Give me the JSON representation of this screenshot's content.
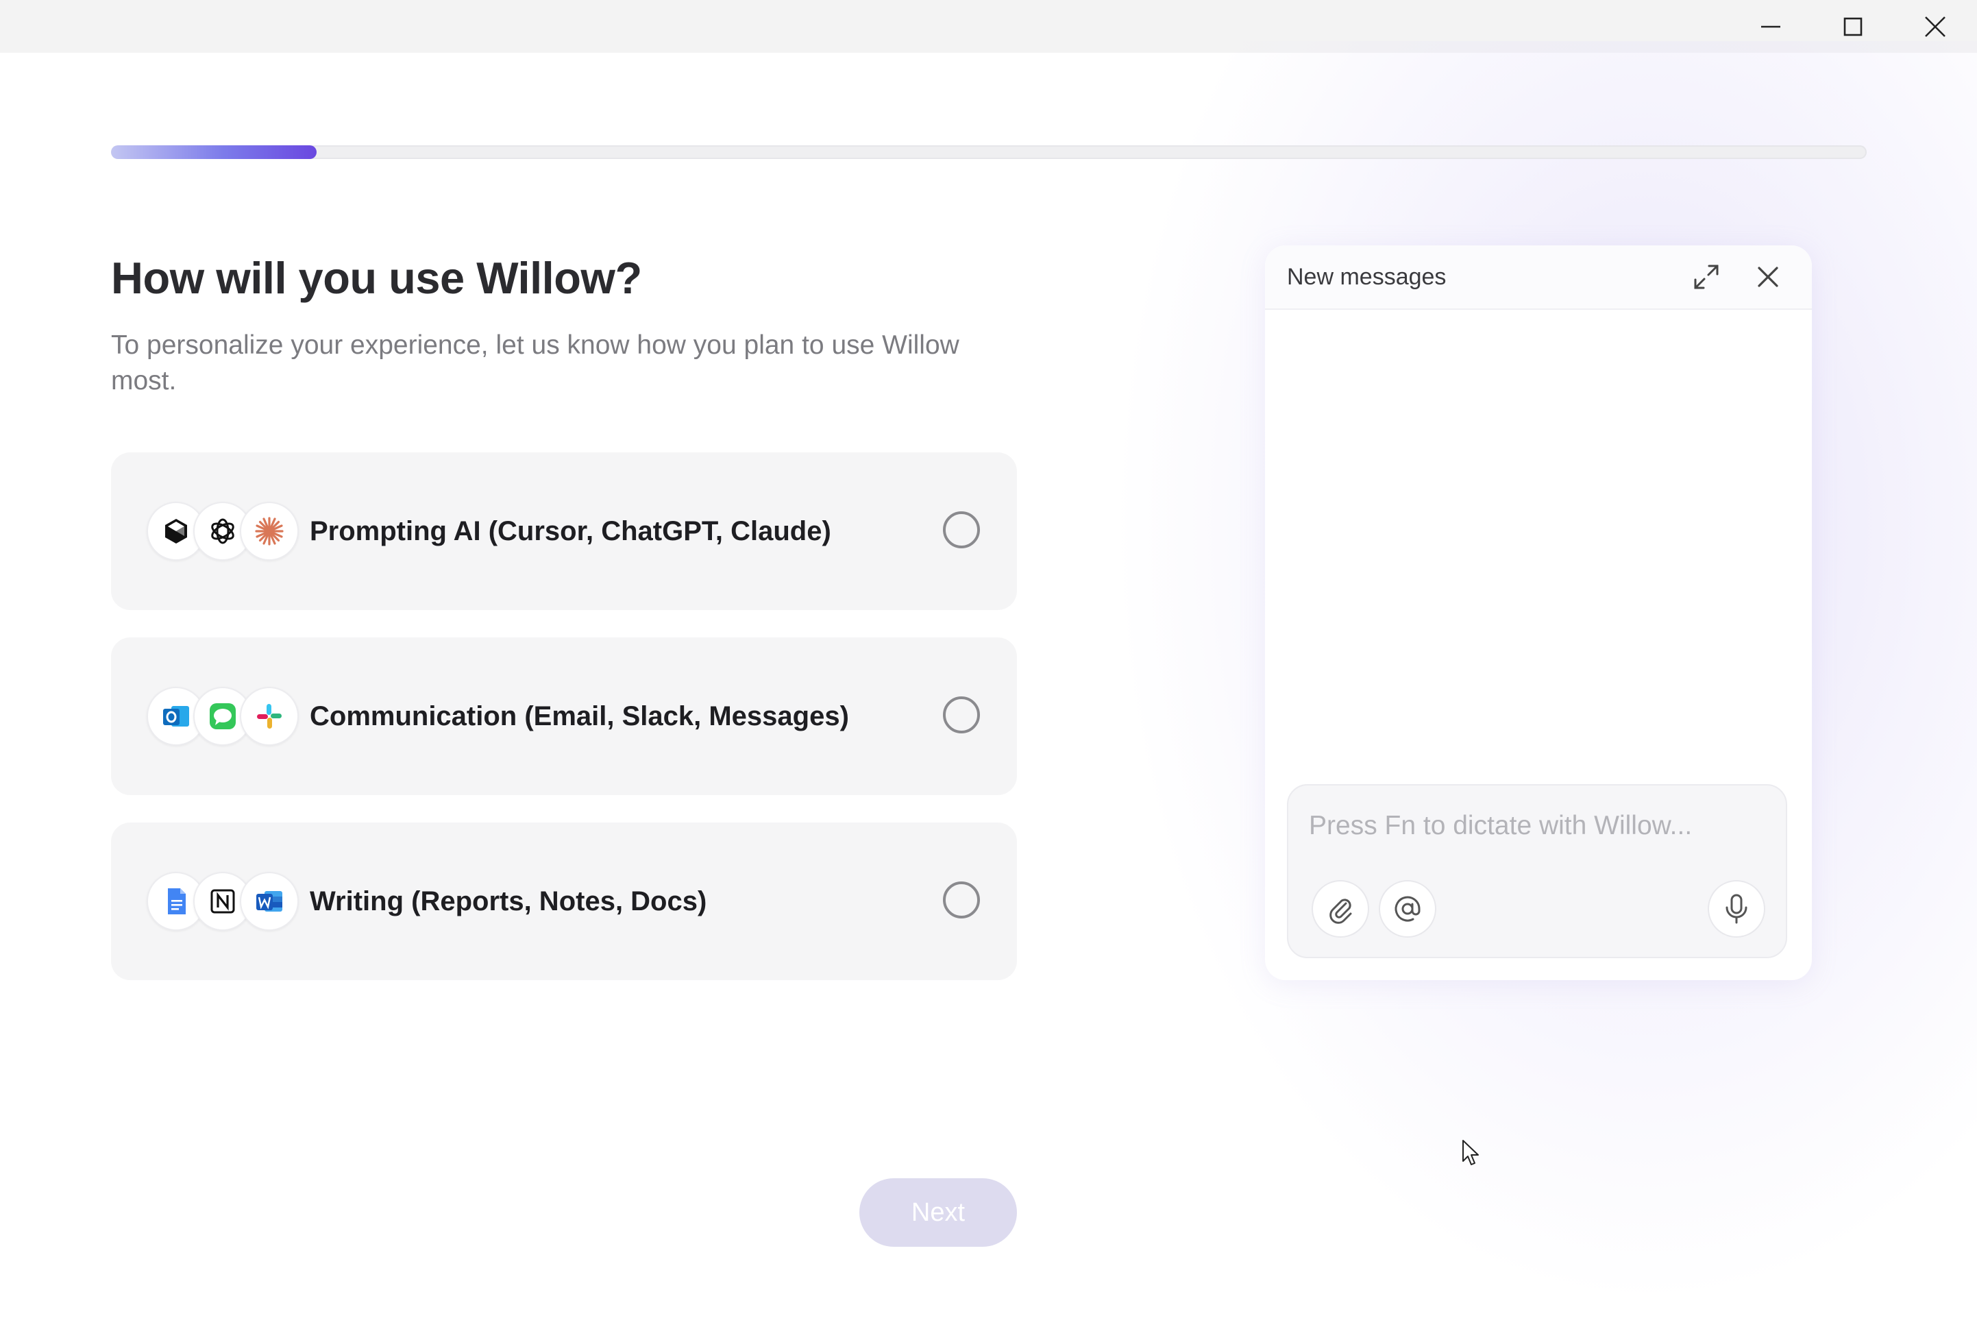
{
  "onboarding": {
    "progress_fraction": 0.117,
    "heading": "How will you use Willow?",
    "subtitle": "To personalize your experience, let us know how you plan to use Willow most.",
    "options": [
      {
        "label": "Prompting AI (Cursor, ChatGPT, Claude)",
        "icons": [
          "cursor-icon",
          "chatgpt-icon",
          "claude-icon"
        ],
        "selected": false
      },
      {
        "label": "Communication (Email, Slack, Messages)",
        "icons": [
          "outlook-icon",
          "messages-icon",
          "slack-icon"
        ],
        "selected": false
      },
      {
        "label": "Writing (Reports, Notes, Docs)",
        "icons": [
          "google-docs-icon",
          "notion-icon",
          "word-icon"
        ],
        "selected": false
      }
    ],
    "next_label": "Next"
  },
  "chat_panel": {
    "title": "New messages",
    "placeholder": "Press Fn to dictate with Willow...",
    "icons": [
      "expand-icon",
      "close-icon",
      "paperclip-icon",
      "at-icon",
      "microphone-icon"
    ]
  },
  "colors": {
    "accent": "#6a48e0",
    "progress_start": "#c3c6f2",
    "next_disabled_bg": "#dddbef",
    "claude_orange": "#d97757",
    "outlook_blue": "#0f6cbd",
    "messages_green": "#34c759",
    "docs_blue": "#4285f4",
    "word_blue": "#185abd"
  }
}
